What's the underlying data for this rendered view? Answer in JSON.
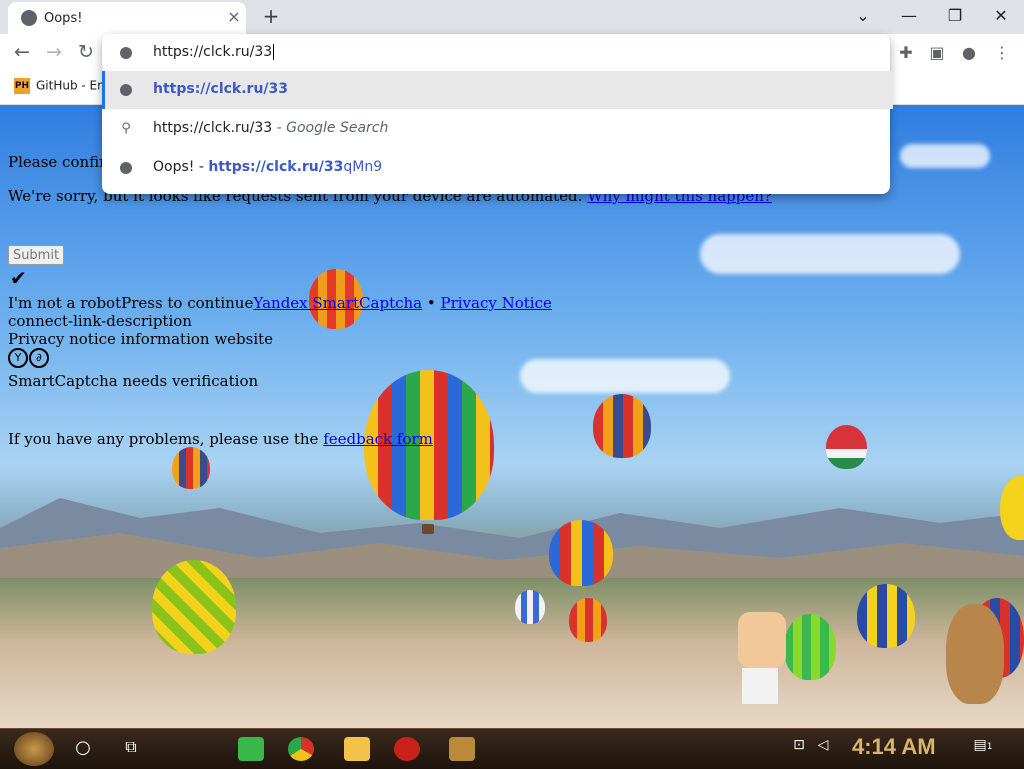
{
  "browser": {
    "tab": {
      "title": "Oops!",
      "close_icon": "×",
      "new_tab_icon": "+"
    },
    "window_controls": {
      "chevron": "⌄",
      "minimize": "—",
      "restore": "❐",
      "close": "✕"
    },
    "nav": {
      "back": "←",
      "forward": "→",
      "reload": "↻"
    },
    "address": {
      "value": "https://clck.ru/33"
    },
    "bookmarks": [
      {
        "icon_text": "PH",
        "label": "GitHub - Er"
      }
    ],
    "extensions": {
      "puzzle": "✚",
      "sidepanel": "▣",
      "profile": "●",
      "menu": "⋮"
    }
  },
  "omnibox": {
    "suggestions": [
      {
        "icon": "globe-icon",
        "url": "https://clck.ru/33",
        "suffix": ""
      },
      {
        "icon": "search-icon",
        "text": "https://clck.ru/33",
        "suffix": " - Google Search"
      },
      {
        "icon": "globe-icon",
        "prefix": "Oops! - ",
        "url": "https://clck.ru/33",
        "suffix": "qMn9"
      }
    ]
  },
  "page": {
    "confirm_text": "Please confirm",
    "sorry_text": "We're sorry, but it looks like requests sent from your device are automated.",
    "why_link": "Why might this happen?",
    "submit_label": "Submit",
    "check_icon": "✔",
    "robot_text": "I'm not a robotPress to continue",
    "smartcaptcha_link": "Yandex SmartCaptcha",
    "bullet": " • ",
    "privacy_link": "Privacy Notice",
    "connect_text": "connect-link-description",
    "privacy_info": "Privacy notice information website",
    "logo_letters": [
      "Y",
      "∂"
    ],
    "needs_verification": "SmartCaptcha needs verification",
    "problems_text": "If you have any problems, please use the ",
    "feedback_link": "feedback form"
  },
  "taskbar": {
    "clock": "4:14 AM",
    "notification_count": "1"
  },
  "colors": {
    "link": "#0000ee",
    "omnibox_url": "#3c5ac7",
    "clock": "#d8b56a"
  }
}
